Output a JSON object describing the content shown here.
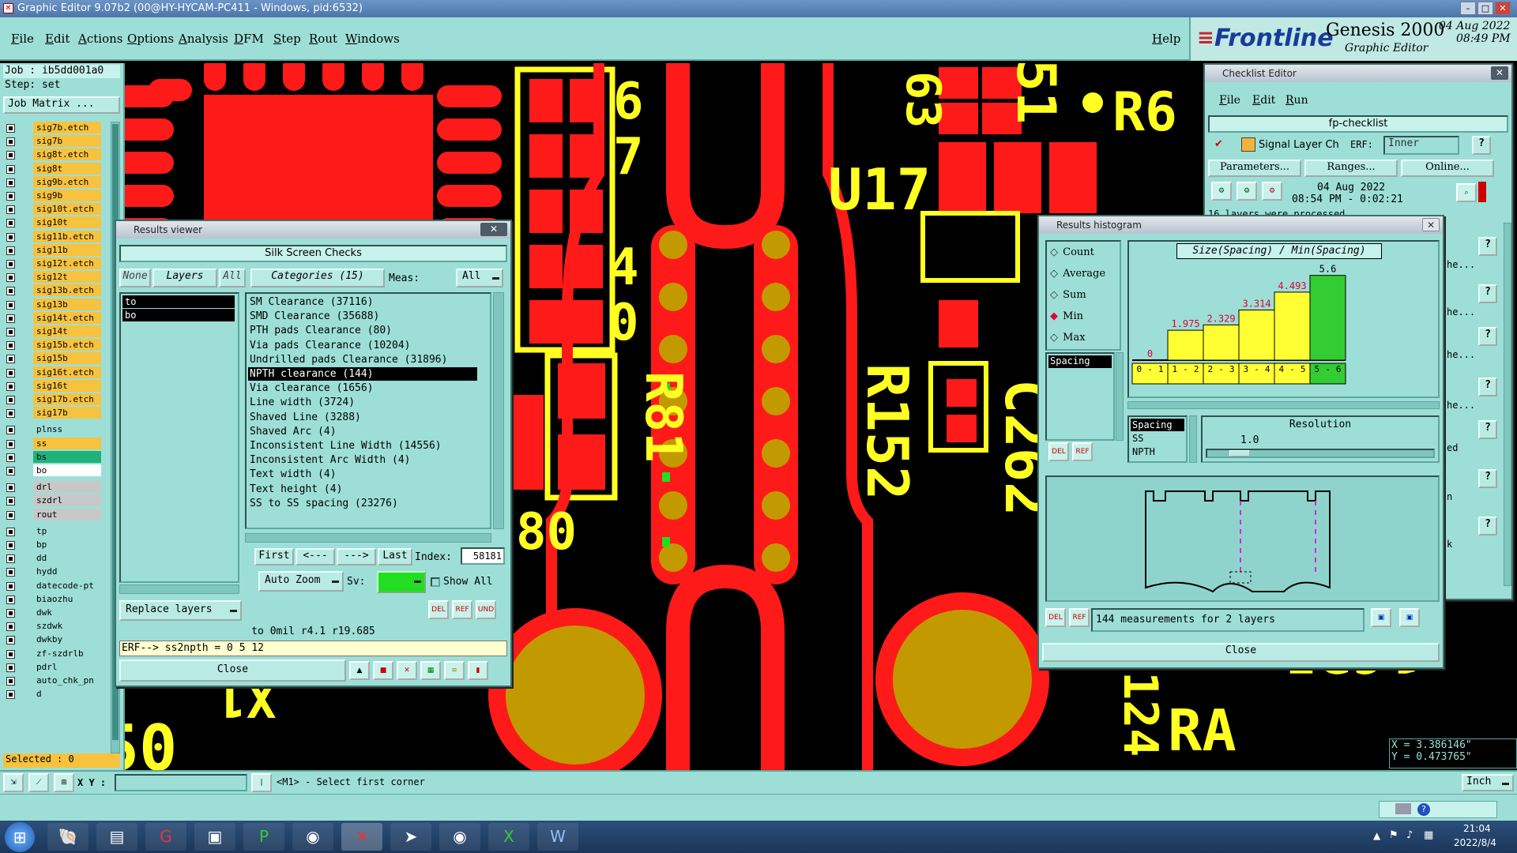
{
  "window": {
    "title": "Graphic Editor 9.07b2 (00@HY-HYCAM-PC411 - Windows, pid:6532)"
  },
  "menu": {
    "items": [
      "File",
      "Edit",
      "Actions",
      "Options",
      "Analysis",
      "DFM",
      "Step",
      "Rout",
      "Windows"
    ],
    "help": "Help"
  },
  "brand": {
    "logo": "Frontline",
    "product": "Genesis 2000",
    "subtitle": "Graphic Editor",
    "date": "04 Aug 2022",
    "time": "08:49 PM"
  },
  "job": {
    "job_label": "Job : ib5dd001a0",
    "step_label": "Step: set",
    "matrix_button": "Job Matrix ..."
  },
  "layers": [
    {
      "name": "sig7b.etch",
      "color": "#f7c23e"
    },
    {
      "name": "sig7b",
      "color": "#f7c23e"
    },
    {
      "name": "sig8t.etch",
      "color": "#f7c23e"
    },
    {
      "name": "sig8t",
      "color": "#f7c23e"
    },
    {
      "name": "sig9b.etch",
      "color": "#f7c23e"
    },
    {
      "name": "sig9b",
      "color": "#f7c23e"
    },
    {
      "name": "sig10t.etch",
      "color": "#f7c23e"
    },
    {
      "name": "sig10t",
      "color": "#f7c23e"
    },
    {
      "name": "sig11b.etch",
      "color": "#f7c23e"
    },
    {
      "name": "sig11b",
      "color": "#f7c23e"
    },
    {
      "name": "sig12t.etch",
      "color": "#f7c23e"
    },
    {
      "name": "sig12t",
      "color": "#f7c23e"
    },
    {
      "name": "sig13b.etch",
      "color": "#f7c23e"
    },
    {
      "name": "sig13b",
      "color": "#f7c23e"
    },
    {
      "name": "sig14t.etch",
      "color": "#f7c23e"
    },
    {
      "name": "sig14t",
      "color": "#f7c23e"
    },
    {
      "name": "sig15b.etch",
      "color": "#f7c23e"
    },
    {
      "name": "sig15b",
      "color": "#f7c23e"
    },
    {
      "name": "sig16t.etch",
      "color": "#f7c23e"
    },
    {
      "name": "sig16t",
      "color": "#f7c23e"
    },
    {
      "name": "sig17b.etch",
      "color": "#f7c23e"
    },
    {
      "name": "sig17b",
      "color": "#f7c23e"
    },
    {
      "name": "plnss",
      "color": "#9ddfd7"
    },
    {
      "name": "ss",
      "color": "#f7c23e"
    },
    {
      "name": "bs",
      "color": "#20b27a"
    },
    {
      "name": "bo",
      "color": "#ffffff"
    },
    {
      "name": "drl",
      "color": "#c8c8c8"
    },
    {
      "name": "szdrl",
      "color": "#c8c8c8"
    },
    {
      "name": "rout",
      "color": "#c8c8c8"
    },
    {
      "name": "tp",
      "color": "#9ddfd7"
    },
    {
      "name": "bp",
      "color": "#9ddfd7"
    },
    {
      "name": "dd",
      "color": "#9ddfd7"
    },
    {
      "name": "hydd",
      "color": "#9ddfd7"
    },
    {
      "name": "datecode-pt",
      "color": "#9ddfd7"
    },
    {
      "name": "biaozhu",
      "color": "#9ddfd7"
    },
    {
      "name": "dwk",
      "color": "#9ddfd7"
    },
    {
      "name": "szdwk",
      "color": "#9ddfd7"
    },
    {
      "name": "dwkby",
      "color": "#9ddfd7"
    },
    {
      "name": "zf-szdrlb",
      "color": "#9ddfd7"
    },
    {
      "name": "pdrl",
      "color": "#9ddfd7"
    },
    {
      "name": "auto_chk_pn",
      "color": "#9ddfd7"
    },
    {
      "name": "d",
      "color": "#9ddfd7"
    }
  ],
  "selected_label": "Selected : 0",
  "board_text": {
    "t63": "63",
    "t51": "51",
    "r6": "R6",
    "u17": "U17",
    "t6": "6",
    "t7": "7",
    "t4": "4",
    "t0": "0",
    "r81": "R81",
    "r152": "R152",
    "c262": "C262",
    "t80": "80",
    "x1": "X1",
    "t50": "50",
    "c25": "1C25",
    "t124": "124",
    "ra": "RA"
  },
  "results_viewer": {
    "title": "Results viewer",
    "header": "Silk Screen Checks",
    "btn_none": "None",
    "btn_layers": "Layers",
    "btn_all": "All",
    "btn_categories": "Categories (15)",
    "meas_label": "Meas:",
    "meas_value": "All",
    "layers": [
      "to",
      "bo"
    ],
    "categories": [
      "SM Clearance (37116)",
      "SMD Clearance (35688)",
      "PTH pads Clearance (80)",
      "Via pads Clearance (10204)",
      "Undrilled pads Clearance (31896)",
      "NPTH clearance (144)",
      "Via clearance (1656)",
      "Line width (3724)",
      "Shaved Line (3288)",
      "Shaved Arc (4)",
      "Inconsistent Line Width (14556)",
      "Inconsistent Arc Width (4)",
      "Text width (4)",
      "Text height (4)",
      "SS to SS spacing (23276)"
    ],
    "selected_category": "NPTH clearance (144)",
    "btn_first": "First",
    "btn_prev": "<---",
    "btn_next": "--->",
    "btn_last": "Last",
    "index_label": "Index:",
    "index_value": "58181",
    "auto_zoom": "Auto Zoom",
    "sv_label": "Sv:",
    "show_all": "Show All",
    "replace_layers": "Replace layers",
    "distance_line": "to 0mil   r4.1  r19.685",
    "erf_line": "ERF--> ss2npth = 0 5 12",
    "close": "Close"
  },
  "checklist_editor": {
    "title": "Checklist Editor",
    "menu": [
      "File",
      "Edit",
      "Run"
    ],
    "checklist_name": "fp-checklist",
    "action_name": "Signal Layer Ch",
    "erf_label": "ERF:",
    "erf_value": "Inner",
    "btn_parameters": "Parameters...",
    "btn_ranges": "Ranges...",
    "btn_online": "Online...",
    "run_date": "04 Aug 2022",
    "run_time": "08:54 PM - 0:02:21",
    "log_line": "16 layers were processed",
    "partial_texts": [
      "he...",
      "he...",
      "he...",
      "he...",
      "ed",
      "n",
      "k"
    ]
  },
  "histogram": {
    "title": "Results histogram",
    "options": [
      "Count",
      "Average",
      "Sum",
      "Min",
      "Max"
    ],
    "selected_option": "Min",
    "list_item": "Spacing",
    "chart_title": "Size(Spacing) / Min(Spacing)",
    "resolution_label": "Resolution",
    "resolution_value": "1.0",
    "filter_items": [
      "Spacing",
      "SS",
      "NPTH"
    ],
    "summary": "144 measurements for 2 layers",
    "close": "Close"
  },
  "chart_data": {
    "type": "bar",
    "title": "Size(Spacing) / Min(Spacing)",
    "categories": [
      "0-1",
      "1-2",
      "2-3",
      "3-4",
      "4-5",
      "5-6"
    ],
    "values": [
      0,
      1.975,
      2.329,
      3.314,
      4.493,
      5.6
    ],
    "ylim": [
      0,
      6
    ],
    "colors": {
      "bar": "#ffff33",
      "last_bar": "#33cc33",
      "label": "#e0003a",
      "last_label": "#000000"
    }
  },
  "status": {
    "xy_label": "X Y :",
    "prompt": "<M1> - Select first corner",
    "x_coord": "X = 3.386146\"",
    "y_coord": "Y = 0.473765\"",
    "units": "Inch"
  },
  "taskbar": {
    "time": "21:04",
    "date": "2022/8/4"
  }
}
